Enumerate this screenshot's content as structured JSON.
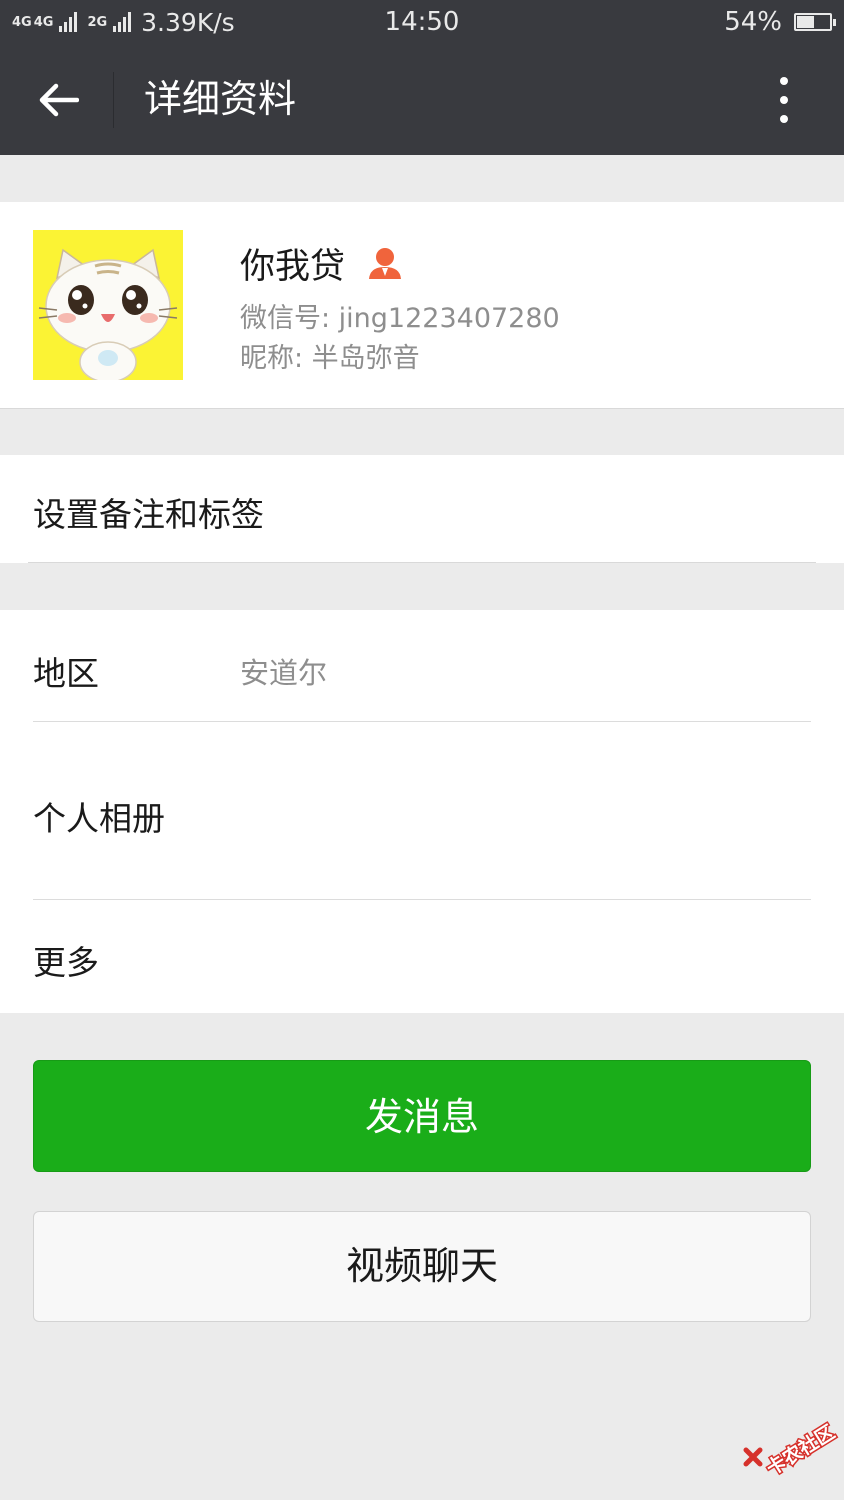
{
  "status_bar": {
    "network_1": "4G",
    "network_2": "4G",
    "network_3": "2G",
    "speed": "3.39K/s",
    "time": "14:50",
    "battery_percent": "54%",
    "battery_level": 0.54
  },
  "title_bar": {
    "title": "详细资料",
    "back_icon": "arrow-left-icon",
    "more_icon": "vertical-dots-icon"
  },
  "profile": {
    "name": "你我贷",
    "wechat_id": "微信号: jing1223407280",
    "nickname": "昵称: 半岛弥音",
    "badge_icon": "person-badge-icon",
    "badge_color": "#f0643c",
    "avatar_bg": "#fbf334"
  },
  "remark": {
    "label": "设置备注和标签"
  },
  "info": {
    "region_label": "地区",
    "region_value": "安道尔",
    "album_label": "个人相册",
    "more_label": "更多"
  },
  "actions": {
    "send_message": "发消息",
    "video_chat": "视频聊天",
    "primary_color": "#1aad19"
  },
  "watermark": {
    "text": "卡农社区"
  }
}
